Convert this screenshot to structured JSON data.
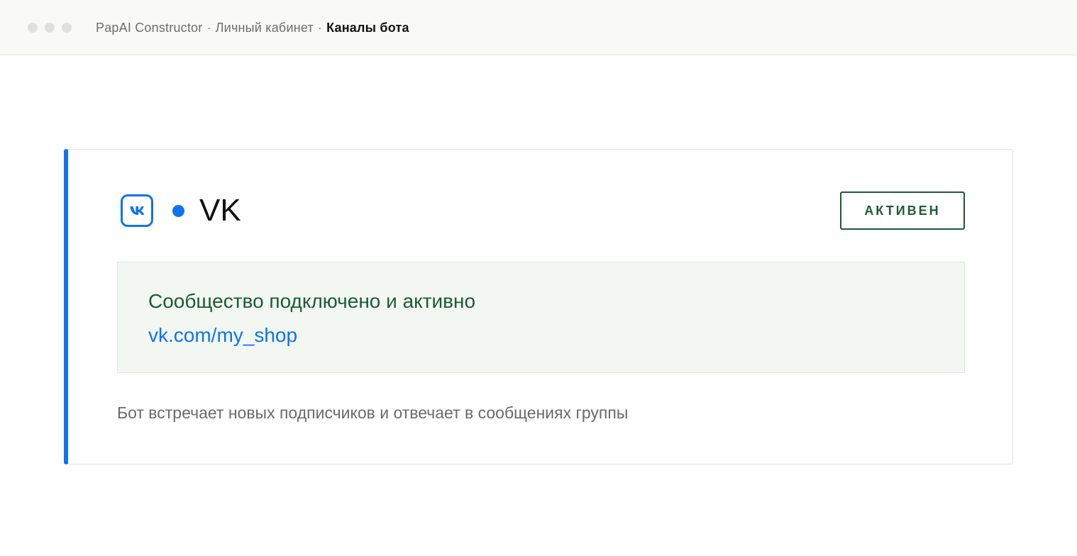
{
  "titlebar": {
    "breadcrumbs": [
      "PapAI Constructor",
      "Личный кабинет",
      "Каналы бота"
    ],
    "separator": "·"
  },
  "channel": {
    "icon": "vk-logo-icon",
    "name": "VK",
    "status_badge": "АКТИВЕН",
    "info": {
      "title": "Сообщество подключено и активно",
      "link": "vk.com/my_shop"
    },
    "description": "Бот встречает новых подписчиков и отвечает в сообщениях группы"
  },
  "colors": {
    "accent": "#0f73ee",
    "success_text": "#1d5a37",
    "success_bg": "#f2f8f1"
  }
}
